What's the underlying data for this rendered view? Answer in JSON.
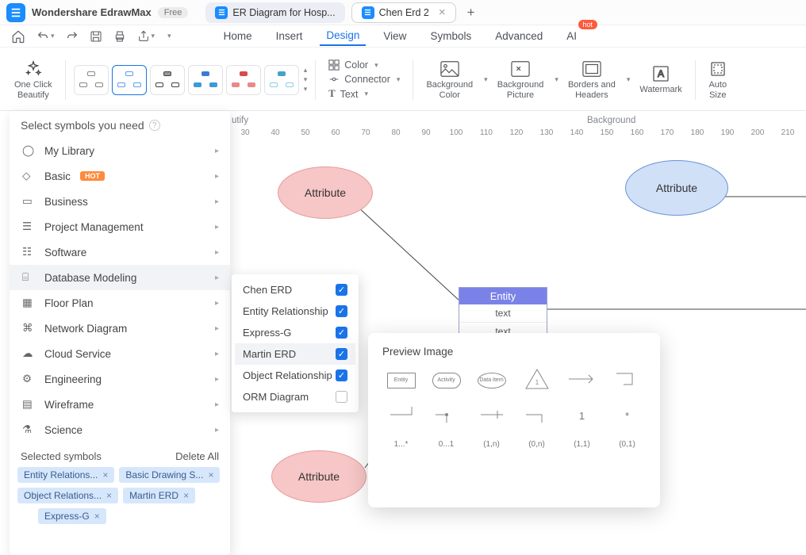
{
  "app": {
    "name": "Wondershare EdrawMax",
    "free_badge": "Free"
  },
  "tabs": [
    {
      "label": "ER Diagram for Hosp...",
      "active": false
    },
    {
      "label": "Chen Erd 2",
      "active": true
    }
  ],
  "menu": {
    "home": "Home",
    "insert": "Insert",
    "design": "Design",
    "view": "View",
    "symbols": "Symbols",
    "advanced": "Advanced",
    "ai": "AI",
    "ai_hot": "hot"
  },
  "ribbon": {
    "oneclick": "One Click\nBeautify",
    "color": "Color",
    "connector": "Connector",
    "text": "Text",
    "bgcolor": "Background\nColor",
    "bgpic": "Background\nPicture",
    "borders": "Borders and\nHeaders",
    "watermark": "Watermark",
    "autosize": "Auto\nSize"
  },
  "section": {
    "utify": "utify",
    "background": "Background"
  },
  "ruler": [
    "30",
    "40",
    "50",
    "60",
    "70",
    "80",
    "90",
    "100",
    "110",
    "120",
    "130",
    "140",
    "150",
    "160",
    "170",
    "180",
    "190",
    "200",
    "210"
  ],
  "canvas": {
    "attr1": "Attribute",
    "attr2": "Attribute",
    "attr3": "Attribute",
    "entity_title": "Entity",
    "entity_row1": "text",
    "entity_row2": "text"
  },
  "sym": {
    "title": "Select symbols you need",
    "items": {
      "mylib": "My Library",
      "basic": "Basic",
      "basic_hot": "HOT",
      "business": "Business",
      "pm": "Project Management",
      "software": "Software",
      "dbmodel": "Database Modeling",
      "floor": "Floor Plan",
      "network": "Network Diagram",
      "cloud": "Cloud Service",
      "eng": "Engineering",
      "wire": "Wireframe",
      "science": "Science"
    },
    "selected_title": "Selected symbols",
    "delete_all": "Delete All",
    "chips": [
      "Entity Relations...",
      "Basic Drawing S...",
      "Object Relations...",
      "Martin ERD",
      "Express-G"
    ]
  },
  "submenu": {
    "chen": "Chen ERD",
    "er": "Entity Relationship",
    "express": "Express-G",
    "martin": "Martin ERD",
    "object": "Object Relationship",
    "orm": "ORM Diagram"
  },
  "preview": {
    "title": "Preview Image",
    "r1": [
      "Entity",
      "Activity",
      "Data Item",
      "",
      "",
      ""
    ],
    "r2": [
      "",
      "",
      "",
      "",
      "1",
      "*"
    ],
    "r3": [
      "1...*",
      "0...1",
      "(1,n)",
      "(0,n)",
      "(1,1)",
      "(0,1)"
    ]
  }
}
